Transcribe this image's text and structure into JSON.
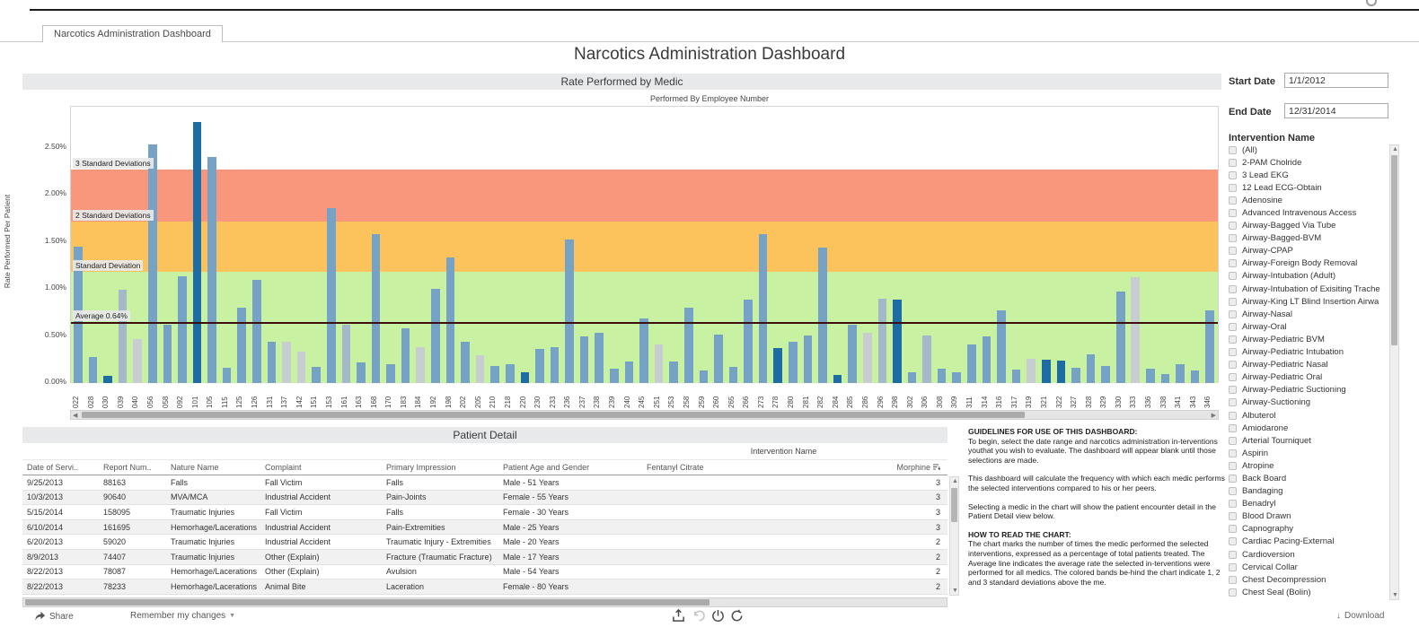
{
  "tab": {
    "label": "Narcotics Administration Dashboard"
  },
  "title": "Narcotics Administration Dashboard",
  "chart_data": {
    "type": "bar",
    "title": "Rate Performed by Medic",
    "xlabel": "Performed By Employee Number",
    "ylabel": "Rate Performed Per Patient",
    "ylim": [
      0,
      2.95
    ],
    "y_ticks": [
      "0.00%",
      "0.50%",
      "1.00%",
      "1.50%",
      "2.00%",
      "2.50%"
    ],
    "categories": [
      "022",
      "028",
      "030",
      "039",
      "040",
      "056",
      "058",
      "092",
      "101",
      "105",
      "115",
      "125",
      "126",
      "131",
      "137",
      "142",
      "151",
      "153",
      "161",
      "163",
      "168",
      "170",
      "183",
      "184",
      "192",
      "198",
      "202",
      "205",
      "210",
      "218",
      "220",
      "230",
      "233",
      "236",
      "237",
      "238",
      "239",
      "240",
      "245",
      "251",
      "253",
      "258",
      "259",
      "260",
      "265",
      "266",
      "273",
      "278",
      "280",
      "281",
      "282",
      "284",
      "285",
      "286",
      "296",
      "298",
      "302",
      "306",
      "308",
      "309",
      "311",
      "314",
      "316",
      "317",
      "319",
      "321",
      "322",
      "327",
      "328",
      "329",
      "330",
      "333",
      "336",
      "338",
      "341",
      "343",
      "346"
    ],
    "values": [
      1.45,
      0.28,
      0.08,
      0.99,
      0.47,
      2.54,
      0.62,
      1.14,
      2.78,
      2.4,
      0.16,
      0.8,
      1.1,
      0.44,
      0.44,
      0.33,
      0.17,
      1.86,
      0.62,
      0.22,
      1.58,
      0.2,
      0.58,
      0.38,
      1.0,
      1.34,
      0.44,
      0.3,
      0.18,
      0.2,
      0.11,
      0.36,
      0.38,
      1.53,
      0.5,
      0.53,
      0.15,
      0.23,
      0.69,
      0.41,
      0.23,
      0.8,
      0.13,
      0.52,
      0.17,
      0.89,
      1.58,
      0.37,
      0.44,
      0.51,
      1.44,
      0.09,
      0.62,
      0.53,
      0.9,
      0.89,
      0.11,
      0.51,
      0.15,
      0.11,
      0.41,
      0.5,
      0.77,
      0.14,
      0.26,
      0.25,
      0.24,
      0.16,
      0.31,
      0.18,
      0.97,
      1.13,
      0.15,
      0.1,
      0.2,
      0.13,
      0.77
    ],
    "bar_colors": [
      "blue",
      "blue",
      "dark",
      "grayblue",
      "gray",
      "blue",
      "blue",
      "blue",
      "dark",
      "blue",
      "blue",
      "blue",
      "blue",
      "blue",
      "gray",
      "gray",
      "blue",
      "blue",
      "grayblue",
      "blue",
      "blue",
      "blue",
      "blue",
      "gray",
      "blue",
      "blue",
      "blue",
      "gray",
      "blue",
      "blue",
      "dark",
      "blue",
      "blue",
      "blue",
      "blue",
      "blue",
      "blue",
      "blue",
      "blue",
      "gray",
      "blue",
      "blue",
      "blue",
      "blue",
      "blue",
      "blue",
      "blue",
      "dark",
      "blue",
      "blue",
      "blue",
      "dark",
      "blue",
      "gray",
      "grayblue",
      "dark",
      "blue",
      "grayblue",
      "blue",
      "blue",
      "blue",
      "blue",
      "blue",
      "blue",
      "gray",
      "dark",
      "dark",
      "blue",
      "blue",
      "blue",
      "blue",
      "gray",
      "blue",
      "blue",
      "blue",
      "blue",
      "blue"
    ],
    "bands": [
      {
        "label": "Standard Deviation",
        "from": 0,
        "to": 1.18,
        "color": "#c8f2a2"
      },
      {
        "label": "2 Standard Deviations",
        "from": 1.18,
        "to": 1.72,
        "color": "#fcc35c"
      },
      {
        "label": "3 Standard Deviations",
        "from": 1.72,
        "to": 2.27,
        "color": "#f8977b"
      }
    ],
    "average": 0.64,
    "average_label": "Average 0.64%",
    "legend_position": "none",
    "grid": false
  },
  "table": {
    "header": "Patient Detail",
    "group_header": "Intervention Name",
    "columns": [
      "Date of Servi..",
      "Report Num..",
      "Nature Name",
      "Complaint",
      "Primary Impression",
      "Patient Age and Gender",
      "Fentanyl Citrate",
      "Morphine"
    ],
    "rows": [
      [
        "9/25/2013",
        "88163",
        "Falls",
        "Fall Victim",
        "Falls",
        "Male - 51 Years",
        "",
        "3"
      ],
      [
        "10/3/2013",
        "90640",
        "MVA/MCA",
        "Industrial Accident",
        "Pain-Joints",
        "Female - 55 Years",
        "",
        "3"
      ],
      [
        "5/15/2014",
        "158095",
        "Traumatic Injuries",
        "Fall Victim",
        "Falls",
        "Female - 30 Years",
        "",
        "3"
      ],
      [
        "6/10/2014",
        "161695",
        "Hemorhage/Lacerations",
        "Industrial Accident",
        "Pain-Extremities",
        "Male - 25 Years",
        "",
        "3"
      ],
      [
        "6/20/2013",
        "59020",
        "Traumatic Injuries",
        "Industrial Accident",
        "Traumatic Injury - Extremities",
        "Male - 20 Years",
        "",
        "2"
      ],
      [
        "8/9/2013",
        "74407",
        "Traumatic Injuries",
        "Other (Explain)",
        "Fracture (Traumatic Fracture)",
        "Male - 17 Years",
        "",
        "2"
      ],
      [
        "8/22/2013",
        "78087",
        "Hemorhage/Lacerations",
        "Other (Explain)",
        "Avulsion",
        "Male - 54 Years",
        "",
        "2"
      ],
      [
        "8/22/2013",
        "78233",
        "Hemorhage/Lacerations",
        "Animal Bite",
        "Laceration",
        "Female - 80 Years",
        "",
        "2"
      ]
    ]
  },
  "guidelines": {
    "heading1": "GUIDELINES FOR USE OF THIS DASHBOARD:",
    "p1": "To begin, select the date range and narcotics administration in-terventions youthat you wish to evaluate.  The dashboard will appear blank until those selections are made.",
    "p2": "This dashboard will calculate the frequency with which each medic performs the selected interventions compared to his or her peers.",
    "p3": "Selecting a medic in the chart will show the patient encounter detail in the Patient Detail view below.",
    "heading2": "HOW TO READ THE CHART:",
    "p4": "The chart marks the number of times the medic performed the selected interventions, expressed as a percentage of total patients treated.  The Average line indicates the average rate the selected in-terventions were performed for all medics.  The colored bands be-hind the chart indicate 1, 2 and 3 standard deviations above the me."
  },
  "filters": {
    "start_date": {
      "label": "Start Date",
      "value": "1/1/2012"
    },
    "end_date": {
      "label": "End Date",
      "value": "12/31/2014"
    },
    "intervention": {
      "label": "Intervention Name",
      "items": [
        "(All)",
        "2-PAM Cholride",
        "3 Lead EKG",
        "12 Lead ECG-Obtain",
        "Adenosine",
        "Advanced Intravenous Access",
        "Airway-Bagged Via Tube",
        "Airway-Bagged-BVM",
        "Airway-CPAP",
        "Airway-Foreign Body Removal",
        "Airway-Intubation (Adult)",
        "Airway-Intubation of Exisiting Trache",
        "Airway-King LT Blind Insertion Airwa",
        "Airway-Nasal",
        "Airway-Oral",
        "Airway-Pediatric BVM",
        "Airway-Pediatric Intubation",
        "Airway-Pediatric Nasal",
        "Airway-Pediatric Oral",
        "Airway-Pediatric Suctioning",
        "Airway-Suctioning",
        "Albuterol",
        "Amiodarone",
        "Arterial Tourniquet",
        "Aspirin",
        "Atropine",
        "Back Board",
        "Bandaging",
        "Benadryl",
        "Blood Drawn",
        "Capnography",
        "Cardiac Pacing-External",
        "Cardioversion",
        "Cervical Collar",
        "Chest Decompression",
        "Chest Seal (Bolin)"
      ]
    }
  },
  "toolbar": {
    "share_label": "Share",
    "remember_label": "Remember my changes",
    "download_label": "Download"
  }
}
